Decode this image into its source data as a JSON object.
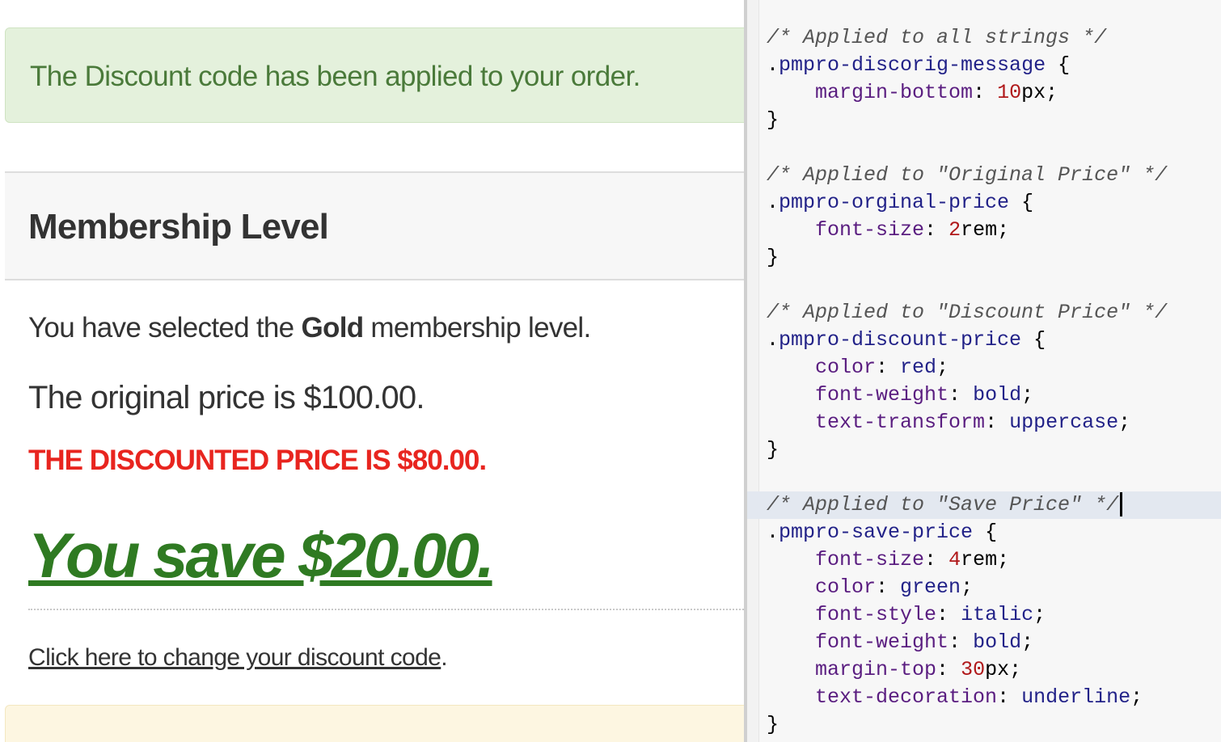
{
  "page": {
    "success_message": "The Discount code has been applied to your order.",
    "level_header_title": "Membership Level",
    "selected_level": {
      "prefix": "You have selected the ",
      "level_name": "Gold",
      "suffix": " membership level."
    },
    "original_price": "The original price is $100.00.",
    "discount_price": "The discounted price is $80.00.",
    "save_price": "You save $20.00.",
    "change_code": {
      "link_text": "Click here to change your discount code",
      "trailing": "."
    }
  },
  "editor": {
    "blocks": [
      {
        "comment": "/* Applied to all strings */",
        "selector": "pmpro-discorig-message",
        "rules": [
          {
            "prop": "margin-bottom",
            "num": "10",
            "unit": "px",
            "word": ""
          }
        ]
      },
      {
        "comment": "/* Applied to \"Original Price\" */",
        "selector": "pmpro-orginal-price",
        "rules": [
          {
            "prop": "font-size",
            "num": "2",
            "unit": "rem",
            "word": ""
          }
        ]
      },
      {
        "comment": "/* Applied to \"Discount Price\" */",
        "selector": "pmpro-discount-price",
        "rules": [
          {
            "prop": "color",
            "num": "",
            "unit": "",
            "word": "red"
          },
          {
            "prop": "font-weight",
            "num": "",
            "unit": "",
            "word": "bold"
          },
          {
            "prop": "text-transform",
            "num": "",
            "unit": "",
            "word": "uppercase"
          }
        ]
      },
      {
        "comment": "/* Applied to \"Save Price\" */",
        "selector": "pmpro-save-price",
        "rules": [
          {
            "prop": "font-size",
            "num": "4",
            "unit": "rem",
            "word": ""
          },
          {
            "prop": "color",
            "num": "",
            "unit": "",
            "word": "green"
          },
          {
            "prop": "font-style",
            "num": "",
            "unit": "",
            "word": "italic"
          },
          {
            "prop": "font-weight",
            "num": "",
            "unit": "",
            "word": "bold"
          },
          {
            "prop": "margin-top",
            "num": "30",
            "unit": "px",
            "word": ""
          },
          {
            "prop": "text-decoration",
            "num": "",
            "unit": "",
            "word": "underline"
          }
        ]
      }
    ]
  },
  "colors": {
    "success_bg": "#e4f1dc",
    "success_text": "#4a7a3a",
    "discount_red": "#e8251f",
    "save_green": "#2f7a22",
    "notice_bg": "#fdf6e1"
  }
}
